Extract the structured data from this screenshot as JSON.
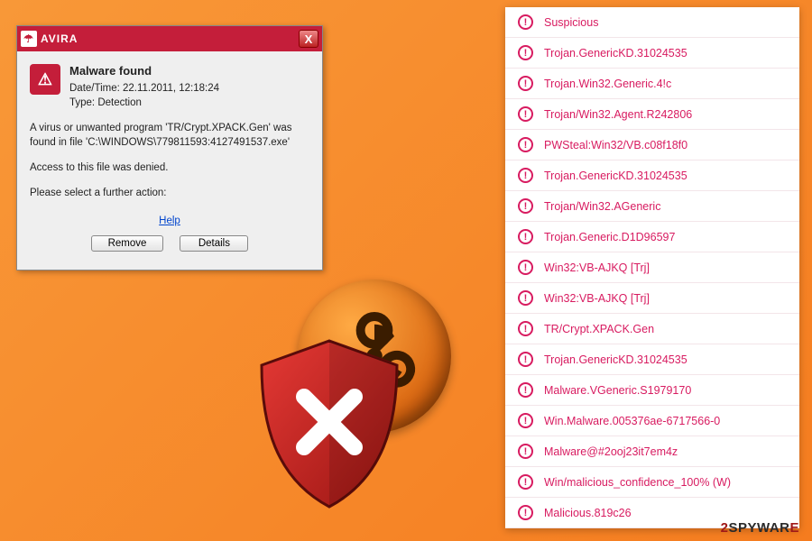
{
  "dialog": {
    "brand": "AVIRA",
    "title": "Malware found",
    "datetime_label": "Date/Time: 22.11.2011, 12:18:24",
    "type_label": "Type: Detection",
    "message1": "A virus or unwanted program 'TR/Crypt.XPACK.Gen' was found in file 'C:\\WINDOWS\\779811593:4127491537.exe'",
    "message2": "Access to this file was denied.",
    "message3": "Please select a further action:",
    "help_label": "Help",
    "remove_label": "Remove",
    "details_label": "Details",
    "close_label": "X"
  },
  "detections": [
    "Suspicious",
    "Trojan.GenericKD.31024535",
    "Trojan.Win32.Generic.4!c",
    "Trojan/Win32.Agent.R242806",
    "PWSteal:Win32/VB.c08f18f0",
    "Trojan.GenericKD.31024535",
    "Trojan/Win32.AGeneric",
    "Trojan.Generic.D1D96597",
    "Win32:VB-AJKQ [Trj]",
    "Win32:VB-AJKQ [Trj]",
    "TR/Crypt.XPACK.Gen",
    "Trojan.GenericKD.31024535",
    "Malware.VGeneric.S1979170",
    "Win.Malware.005376ae-6717566-0",
    "Malware@#2ooj23it7em4z",
    "Win/malicious_confidence_100% (W)",
    "Malicious.819c26"
  ],
  "watermark": {
    "part1": "2",
    "part2": "SPYWAR",
    "part3": "E"
  }
}
